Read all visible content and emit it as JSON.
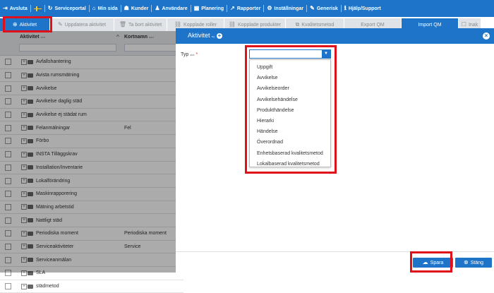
{
  "topnav": {
    "items": [
      {
        "icon": "sign-out-icon",
        "glyph": "⇥",
        "label": "Avsluta"
      },
      {
        "icon": "swedish-flag-icon",
        "glyph": "",
        "label": ""
      },
      {
        "icon": "service-portal-icon",
        "glyph": "↻",
        "label": "Serviceportal"
      },
      {
        "icon": "dashboard-icon",
        "glyph": "⌂",
        "label": "Min sida"
      },
      {
        "icon": "customers-icon",
        "glyph": "☗",
        "label": "Kunder"
      },
      {
        "icon": "user-icon",
        "glyph": "♟",
        "label": "Användare"
      },
      {
        "icon": "calendar-icon",
        "glyph": "▦",
        "label": "Planering"
      },
      {
        "icon": "chart-icon",
        "glyph": "↗",
        "label": "Rapporter"
      },
      {
        "icon": "cogs-icon",
        "glyph": "⚙",
        "label": "Inställningar"
      },
      {
        "icon": "wrench-icon",
        "glyph": "✎",
        "label": "Generisk"
      },
      {
        "icon": "info-icon",
        "glyph": "ℹ",
        "label": "Hjälp/Support"
      }
    ]
  },
  "toolbar": {
    "tabs": [
      {
        "label": "Aktivitet",
        "icon": "plus-circle-icon",
        "glyph": "⊕",
        "active": true
      },
      {
        "label": "Uppdatera aktivitet",
        "icon": "pencil-icon",
        "glyph": "✎",
        "active": false
      },
      {
        "label": "Ta bort aktivitet",
        "icon": "trash-icon",
        "glyph": "🗑",
        "active": false
      },
      {
        "label": "Kopplade roller",
        "icon": "link-icon",
        "glyph": "⛓",
        "active": false
      },
      {
        "label": "Kopplade produkter",
        "icon": "link-icon",
        "glyph": "⛓",
        "active": false
      },
      {
        "label": "Kvalitetsmetod",
        "icon": "copy-icon",
        "glyph": "⧉",
        "active": false
      },
      {
        "label": "Export QM",
        "icon": "",
        "glyph": "",
        "active": false
      },
      {
        "label": "Import QM",
        "icon": "",
        "glyph": "",
        "active": true
      },
      {
        "label": "Inak",
        "icon": "checkbox-icon",
        "glyph": "☐",
        "active": false
      }
    ]
  },
  "grid": {
    "col_activity": "Aktivitet",
    "col_activity_sub": "sort",
    "col_shortname": "Kortnamn",
    "col_shortname_sub": "sort",
    "rows": [
      {
        "label": "Avfallshantering",
        "short": ""
      },
      {
        "label": "Avista rumsmätning",
        "short": ""
      },
      {
        "label": "Avvikelse",
        "short": ""
      },
      {
        "label": "Avvikelse daglig städ",
        "short": ""
      },
      {
        "label": "Avvikelse ej städat rum",
        "short": ""
      },
      {
        "label": "Felanmälningar",
        "short": "Fel"
      },
      {
        "label": "Förbo",
        "short": ""
      },
      {
        "label": "INSTA Tilläggskrav",
        "short": ""
      },
      {
        "label": "Installation/Inventarie",
        "short": ""
      },
      {
        "label": "Lokalförändring",
        "short": ""
      },
      {
        "label": "Maskinrapporering",
        "short": ""
      },
      {
        "label": "Mätning arbetstid",
        "short": ""
      },
      {
        "label": "Nattligt städ",
        "short": ""
      },
      {
        "label": "Periodiska moment",
        "short": "Periodiska moment"
      },
      {
        "label": "Serviceaktiviteter",
        "short": "Service"
      },
      {
        "label": "Serviceanmälan",
        "short": ""
      },
      {
        "label": "SLA",
        "short": ""
      },
      {
        "label": "städmetod",
        "short": ""
      }
    ]
  },
  "modal": {
    "title": "Aktivitet",
    "title_sub": "ny",
    "field_label": "Typ",
    "field_sub": "ska",
    "required_mark": "*",
    "select_value": "",
    "options": [
      "Uppgift",
      "Avvikelse",
      "Avvikelseorder",
      "Avvikelsehändelse",
      "Produkthändelse",
      "Hierarki",
      "Händelse",
      "Överordnad",
      "Enhetsbaserad kvalitetsmetod",
      "Lokalbaserad kvalitetsmetod"
    ],
    "save_label": "Spara",
    "close_label": "Stäng"
  },
  "colors": {
    "accent": "#1e74c9",
    "highlight": "#e0101b"
  }
}
